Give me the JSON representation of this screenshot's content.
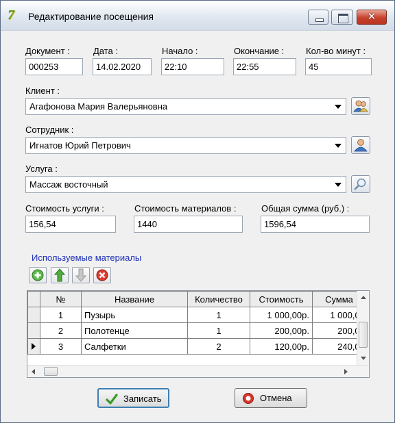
{
  "window": {
    "title": "Редактирование посещения"
  },
  "fields": {
    "document": {
      "label": "Документ :",
      "value": "000253"
    },
    "date": {
      "label": "Дата :",
      "value": "14.02.2020"
    },
    "start": {
      "label": "Начало :",
      "value": "22:10"
    },
    "end": {
      "label": "Окончание :",
      "value": "22:55"
    },
    "minutes": {
      "label": "Кол-во минут :",
      "value": "45"
    },
    "client": {
      "label": "Клиент :",
      "value": "Агафонова Мария  Валерьяновна"
    },
    "employee": {
      "label": "Сотрудник :",
      "value": "Игнатов Юрий  Петрович"
    },
    "service": {
      "label": "Услуга :",
      "value": "Массаж восточный"
    },
    "service_cost": {
      "label": "Стоимость услуги :",
      "value": "156,54"
    },
    "materials_cost": {
      "label": "Стоимость материалов :",
      "value": "1440"
    },
    "total": {
      "label": "Общая сумма (руб.) :",
      "value": "1596,54"
    }
  },
  "materials": {
    "title": "Используемые материалы",
    "columns": [
      "№",
      "Название",
      "Количество",
      "Стоимость",
      "Сумма"
    ],
    "rows": [
      {
        "num": "1",
        "name": "Пузырь",
        "qty": "1",
        "cost": "1 000,00р.",
        "sum": "1 000,0("
      },
      {
        "num": "2",
        "name": "Полотенце",
        "qty": "1",
        "cost": "200,00р.",
        "sum": "200,0("
      },
      {
        "num": "3",
        "name": "Салфетки",
        "qty": "2",
        "cost": "120,00р.",
        "sum": "240,0("
      }
    ]
  },
  "buttons": {
    "save": "Записать",
    "cancel": "Отмена"
  },
  "colors": {
    "group_title": "#1d2fb8",
    "close_button": "#c7412c"
  }
}
